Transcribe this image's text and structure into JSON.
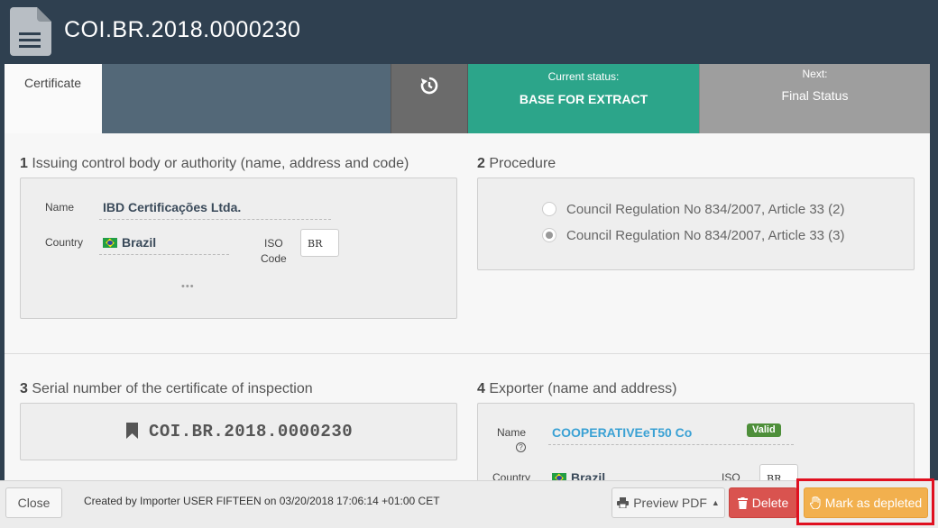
{
  "header": {
    "title": "COI.BR.2018.0000230",
    "icon": "document-icon"
  },
  "statusbar": {
    "tab_label": "Certificate",
    "current_caption": "Current status:",
    "current_value": "BASE FOR EXTRACT",
    "next_caption": "Next:",
    "next_value": "Final Status",
    "colors": {
      "current": "#2ca58a",
      "next": "#9e9e9e"
    }
  },
  "section1": {
    "number": "1",
    "title": "Issuing control body or authority (name, address and code)",
    "name_label": "Name",
    "name_value": "IBD Certificações Ltda.",
    "country_label": "Country",
    "country_value": "Brazil",
    "iso_label_1": "ISO",
    "iso_label_2": "Code",
    "iso_value": "BR",
    "more": "•••"
  },
  "section2": {
    "number": "2",
    "title": "Procedure",
    "options": [
      {
        "label": "Council Regulation No 834/2007, Article 33 (2)",
        "selected": false
      },
      {
        "label": "Council Regulation No 834/2007, Article 33 (3)",
        "selected": true
      }
    ]
  },
  "section3": {
    "number": "3",
    "title": "Serial number of the certificate of inspection",
    "serial": "COI.BR.2018.0000230"
  },
  "section4": {
    "number": "4",
    "title": "Exporter (name and address)",
    "name_label": "Name",
    "help": "?",
    "name_value": "COOPERATIVEeT50 Co",
    "badge": "Valid",
    "country_label": "Country",
    "country_value": "Brazil",
    "iso_label": "ISO",
    "iso_value": "BR"
  },
  "footer": {
    "close": "Close",
    "created": "Created by Importer USER FIFTEEN on 03/20/2018 17:06:14 +01:00 CET",
    "preview": "Preview PDF",
    "delete": "Delete",
    "depleted": "Mark as depleted"
  }
}
